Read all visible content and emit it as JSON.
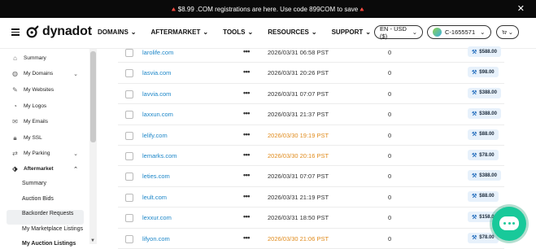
{
  "banner": {
    "text": "🔺$8.99 .COM registrations are here. Use code 899COM to save🔺",
    "close": "✕"
  },
  "header": {
    "logo_text": "dynadot",
    "menu": [
      {
        "label": "DOMAINS"
      },
      {
        "label": "AFTERMARKET"
      },
      {
        "label": "TOOLS"
      },
      {
        "label": "RESOURCES"
      },
      {
        "label": "SUPPORT"
      }
    ],
    "language": "EN - USD ($)",
    "account": "C-1655571",
    "cart_icon": "cart-icon"
  },
  "sidebar": {
    "items": [
      {
        "label": "Summary",
        "icon": "home-icon"
      },
      {
        "label": "My Domains",
        "icon": "globe-icon"
      },
      {
        "label": "My Websites",
        "icon": "brush-icon"
      },
      {
        "label": "My Logos",
        "icon": "palette-icon"
      },
      {
        "label": "My Emails",
        "icon": "mail-icon"
      },
      {
        "label": "My SSL",
        "icon": "lock-icon"
      },
      {
        "label": "My Parking",
        "icon": "parking-icon"
      },
      {
        "label": "Aftermarket",
        "icon": "tag-icon"
      }
    ],
    "sub_items": [
      {
        "label": "Summary"
      },
      {
        "label": "Auction Bids"
      },
      {
        "label": "Backorder Requests"
      },
      {
        "label": "My Marketplace Listings"
      },
      {
        "label": "My Auction Listings"
      }
    ]
  },
  "table": {
    "rows": [
      {
        "domain": "larolife.com",
        "date": "2026/03/31 06:58 PST",
        "bids": "0",
        "price": "$588.00",
        "highlight": false
      },
      {
        "domain": "lasvia.com",
        "date": "2026/03/31 20:26 PST",
        "bids": "0",
        "price": "$98.00",
        "highlight": false
      },
      {
        "domain": "lavvia.com",
        "date": "2026/03/31 07:07 PST",
        "bids": "0",
        "price": "$388.00",
        "highlight": false
      },
      {
        "domain": "laxxun.com",
        "date": "2026/03/31 21:37 PST",
        "bids": "0",
        "price": "$388.00",
        "highlight": false
      },
      {
        "domain": "lelify.com",
        "date": "2026/03/30 19:19 PST",
        "bids": "0",
        "price": "$88.00",
        "highlight": true
      },
      {
        "domain": "lemarks.com",
        "date": "2026/03/30 20:16 PST",
        "bids": "0",
        "price": "$78.00",
        "highlight": true
      },
      {
        "domain": "leties.com",
        "date": "2026/03/31 07:07 PST",
        "bids": "0",
        "price": "$388.00",
        "highlight": false
      },
      {
        "domain": "leult.com",
        "date": "2026/03/31 21:19 PST",
        "bids": "0",
        "price": "$88.00",
        "highlight": false
      },
      {
        "domain": "lexxur.com",
        "date": "2026/03/31 18:50 PST",
        "bids": "0",
        "price": "$158.00",
        "highlight": false
      },
      {
        "domain": "lifyon.com",
        "date": "2026/03/30 21:06 PST",
        "bids": "0",
        "price": "$78.00",
        "highlight": true
      }
    ],
    "more_icon": "more-icon",
    "price_icon": "gavel-icon"
  },
  "colors": {
    "link": "#1c86c8",
    "highlight_date": "#e08a1a",
    "chat": "#18c99a"
  },
  "chat_icon": "chat-icon"
}
